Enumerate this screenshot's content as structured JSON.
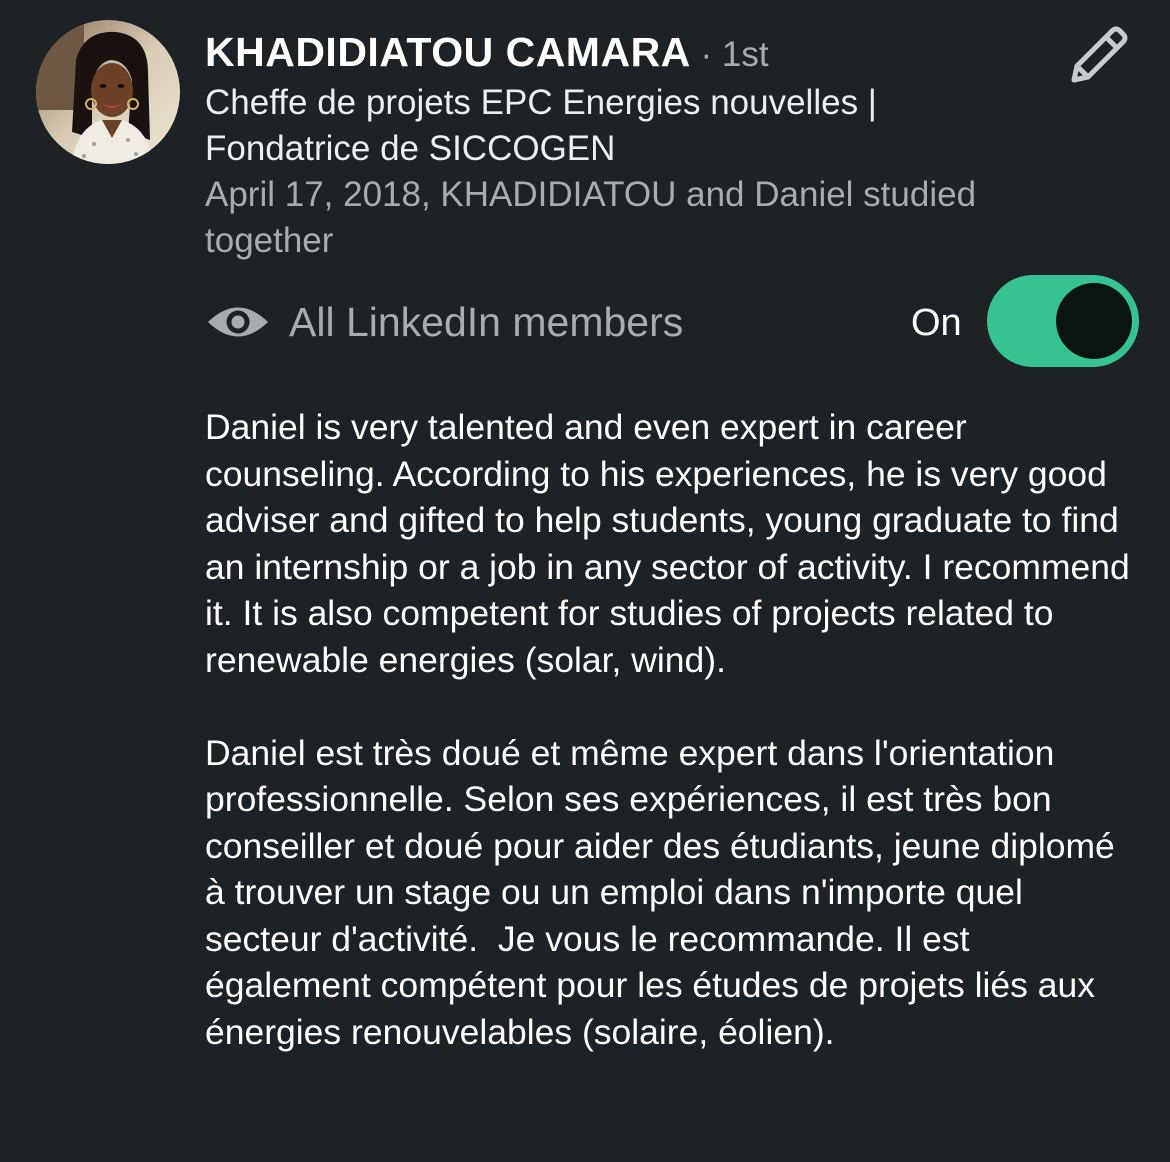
{
  "profile": {
    "name": "KHADIDIATOU CAMARA",
    "degree_separator": " · ",
    "degree": "1st",
    "headline": "Cheffe de projets EPC Energies nouvelles | Fondatrice de SICCOGEN",
    "meta": "April 17, 2018, KHADIDIATOU and Daniel studied together",
    "avatar_icon": "profile-photo",
    "edit_icon": "pencil-icon"
  },
  "visibility": {
    "icon": "eye-icon",
    "label": "All LinkedIn members",
    "state_label": "On",
    "enabled": true
  },
  "recommendation": {
    "paragraphs": [
      "Daniel is very talented and even expert in career counseling. According to his experiences, he is very good adviser and gifted to help students, young graduate to find an internship or a job in any sector of activity. I recommend it. It is also competent for studies of projects related to renewable energies (solar, wind).",
      "Daniel est très doué et même expert dans l'orientation professionnelle. Selon ses expériences, il est très bon conseiller et doué pour aider des étudiants, jeune diplomé à trouver un stage ou un emploi dans n'importe quel secteur d'activité.  Je vous le recommande. Il est également compétent pour les études de projets liés aux énergies renouvelables (solaire, éolien)."
    ]
  },
  "colors": {
    "background": "#1d2226",
    "primary_text": "#ffffff",
    "secondary_text": "#a8acaf",
    "toggle_track": "#37c391",
    "toggle_knob": "#0a1512"
  }
}
